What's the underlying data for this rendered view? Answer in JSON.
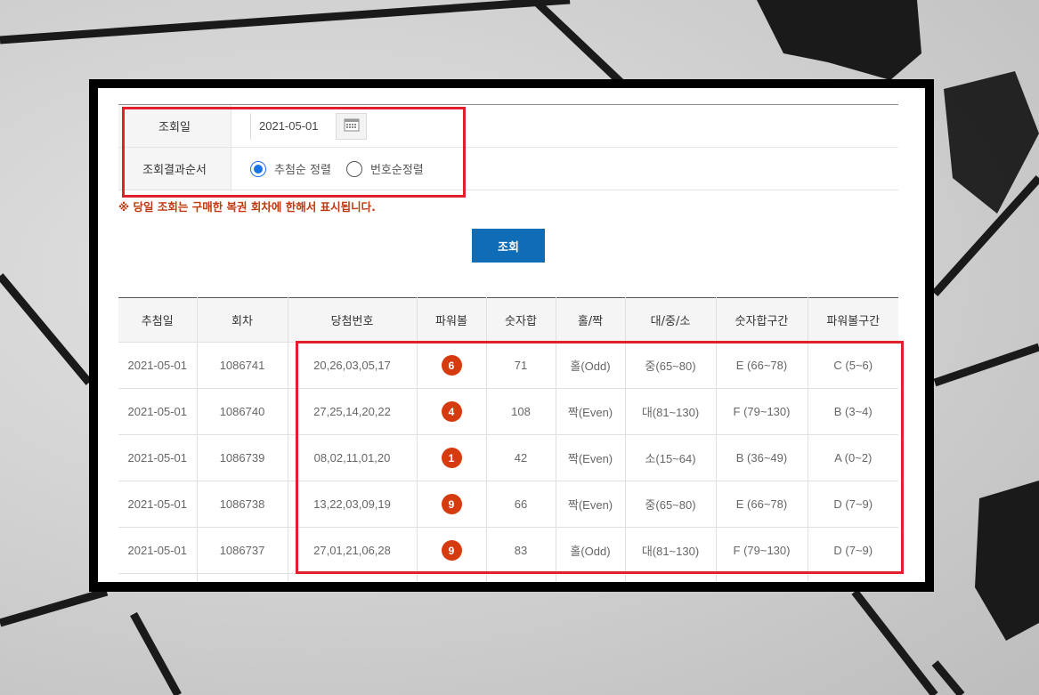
{
  "form": {
    "date_label": "조회일",
    "date_value": "2021-05-01",
    "order_label": "조회결과순서",
    "order_options": [
      {
        "label": "추첨순 정렬",
        "checked": true
      },
      {
        "label": "번호순정렬",
        "checked": false
      }
    ]
  },
  "notice": "※ 당일 조회는 구매한 복권 회차에 한해서 표시됩니다.",
  "search_button": "조회",
  "table": {
    "headers": [
      "추첨일",
      "회차",
      "당첨번호",
      "파워볼",
      "숫자합",
      "홀/짝",
      "대/중/소",
      "숫자합구간",
      "파워볼구간"
    ],
    "rows": [
      {
        "date": "2021-05-01",
        "round": "1086741",
        "numbers": "20,26,03,05,17",
        "powerball": "6",
        "sum": "71",
        "odd_even": "홀(Odd)",
        "size": "중(65~80)",
        "sum_range": "E (66~78)",
        "pb_range": "C (5~6)"
      },
      {
        "date": "2021-05-01",
        "round": "1086740",
        "numbers": "27,25,14,20,22",
        "powerball": "4",
        "sum": "108",
        "odd_even": "짝(Even)",
        "size": "대(81~130)",
        "sum_range": "F (79~130)",
        "pb_range": "B (3~4)"
      },
      {
        "date": "2021-05-01",
        "round": "1086739",
        "numbers": "08,02,11,01,20",
        "powerball": "1",
        "sum": "42",
        "odd_even": "짝(Even)",
        "size": "소(15~64)",
        "sum_range": "B (36~49)",
        "pb_range": "A (0~2)"
      },
      {
        "date": "2021-05-01",
        "round": "1086738",
        "numbers": "13,22,03,09,19",
        "powerball": "9",
        "sum": "66",
        "odd_even": "짝(Even)",
        "size": "중(65~80)",
        "sum_range": "E (66~78)",
        "pb_range": "D (7~9)"
      },
      {
        "date": "2021-05-01",
        "round": "1086737",
        "numbers": "27,01,21,06,28",
        "powerball": "9",
        "sum": "83",
        "odd_even": "홀(Odd)",
        "size": "대(81~130)",
        "sum_range": "F (79~130)",
        "pb_range": "D (7~9)"
      }
    ]
  },
  "colors": {
    "accent_button": "#0f6cb6",
    "ball": "#d63a0f",
    "highlight": "#e0202a",
    "notice": "#c0390f"
  }
}
